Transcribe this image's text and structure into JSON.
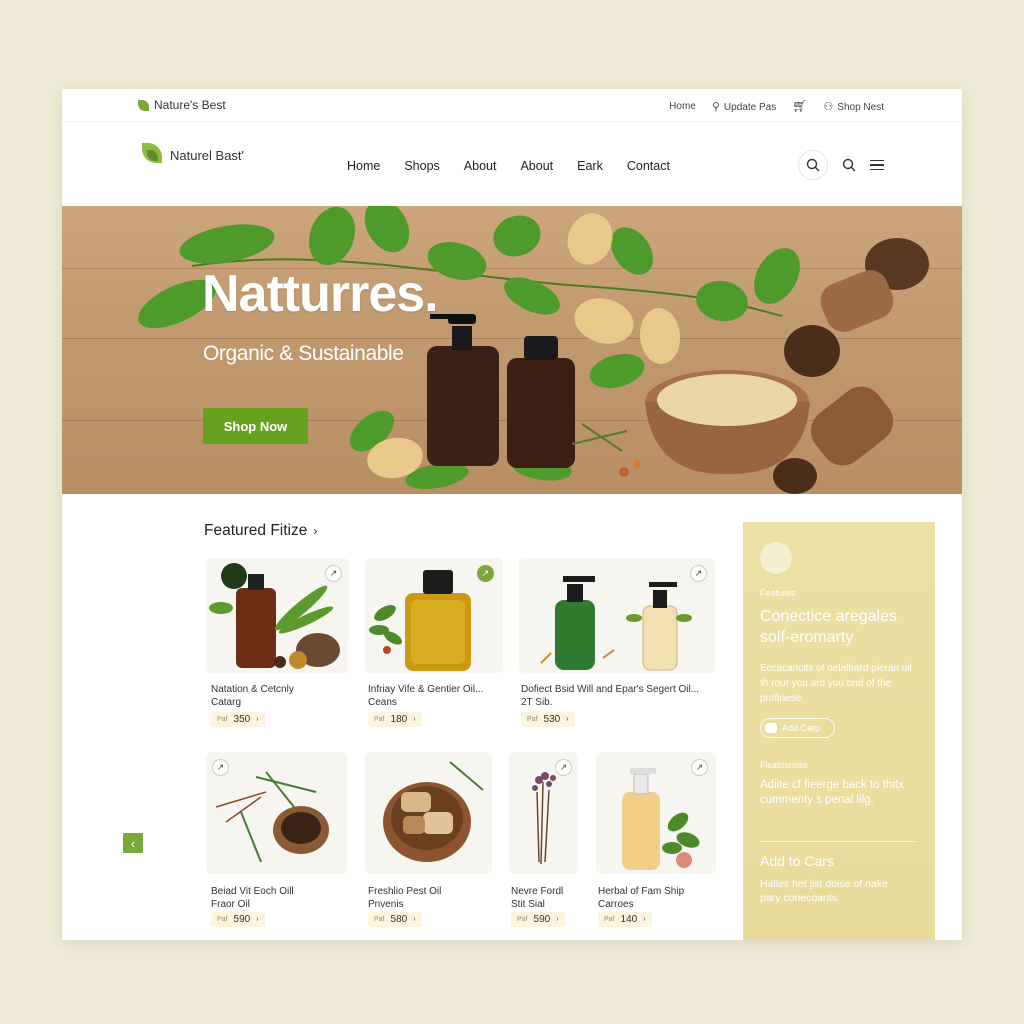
{
  "util": {
    "logo_text": "Nature's Best",
    "links": [
      "Home",
      "Update Pas",
      "Shop Nest"
    ]
  },
  "nav": {
    "brand": "Naturel Bast'",
    "links": [
      "Home",
      "Shops",
      "About",
      "About",
      "Eark",
      "Contact"
    ]
  },
  "hero": {
    "title": "Natturres.",
    "subtitle": "Organic & Sustainable",
    "cta": "Shop Now"
  },
  "featured": {
    "title": "Featured Fitize",
    "chevron": "›"
  },
  "products": [
    {
      "name": "Natation & Cetcnly",
      "name2": "Catarg",
      "currency": "Paf",
      "price": "350",
      "arrow": "›"
    },
    {
      "name": "Infriay Vife & Gentier Oil...",
      "name2": "Ceans",
      "currency": "Paf",
      "price": "180",
      "arrow": "›"
    },
    {
      "name": "Dofiect Bsid Will and Epar's Segert Oil...",
      "name2": "2T Sib.",
      "currency": "Paf",
      "price": "530",
      "arrow": "›"
    },
    {
      "name": "Beiad Vit Eoch Oill",
      "name2": "Fraor Oil",
      "currency": "Paf",
      "price": "590",
      "arrow": "›"
    },
    {
      "name": "Freshlio Pest Oil",
      "name2": "Pnvenis",
      "currency": "Paf",
      "price": "580",
      "arrow": "›"
    },
    {
      "name": "Nevre Fordl",
      "name2": "Stit Sial",
      "currency": "Paf",
      "price": "590",
      "arrow": "›"
    },
    {
      "name": "Herbal of Fam Ship",
      "name2": "Carroes",
      "currency": "Paf",
      "price": "140",
      "arrow": "›"
    }
  ],
  "sidebar": {
    "eyebrow": "Features",
    "heading": "Conectice aregales solf-eromarty",
    "body": "Eccacancits of oelalbard pieran oil th rour you ard you bnd of the profinese.",
    "pill": "Add Carp",
    "eyebrow2": "Ficatosnelis",
    "body2": "Adiite cf fieerge back to thitx cummenty s penal lilg.",
    "heading2": "Add to Cars",
    "body3": "Halles het jist doise of nake pary conecoants."
  },
  "icons": {
    "search": "search-icon",
    "user": "user-icon",
    "cart": "cart-icon",
    "menu": "menu-icon",
    "location": "location-icon",
    "back": "chevron-left-icon"
  },
  "colors": {
    "accent": "#66a11f",
    "sidebar": "#e8dda0",
    "background": "#efebd6"
  }
}
